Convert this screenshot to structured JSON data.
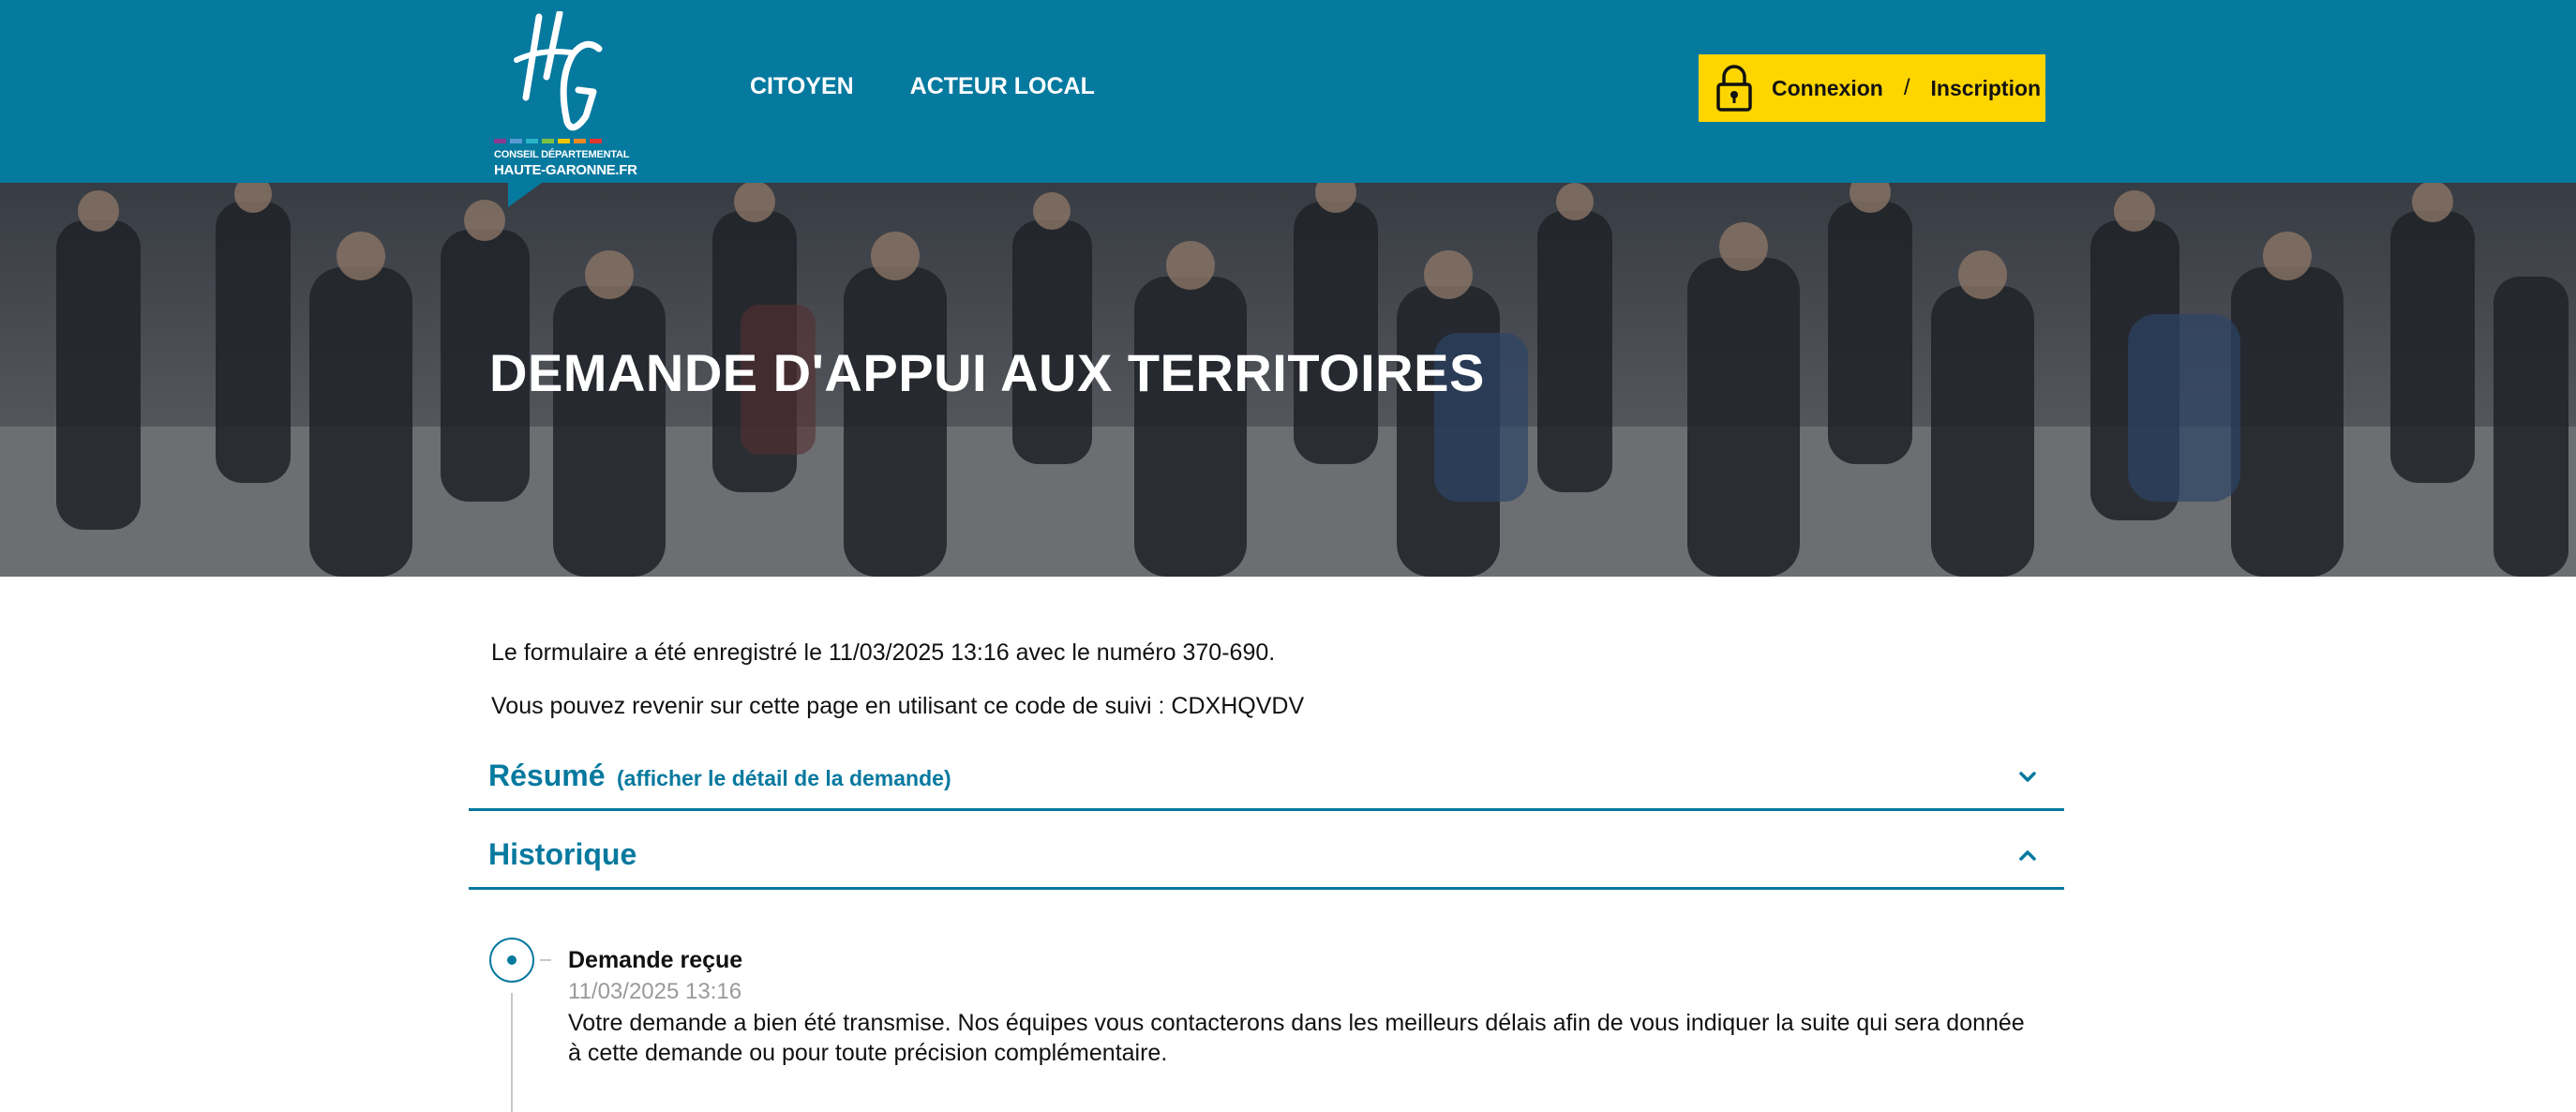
{
  "brand": {
    "logo_letters": "HG",
    "logo_line1": "CONSEIL DÉPARTEMENTAL",
    "logo_line2": "HAUTE-GARONNE.FR",
    "primary_color": "#06799f",
    "accent_color": "#ffd500"
  },
  "nav": {
    "items": [
      {
        "label": "CITOYEN"
      },
      {
        "label": "ACTEUR LOCAL"
      }
    ]
  },
  "auth": {
    "icon": "lock-icon",
    "login_label": "Connexion",
    "separator": "/",
    "signup_label": "Inscription"
  },
  "hero": {
    "title": "DEMANDE D'APPUI AUX TERRITOIRES"
  },
  "confirmation": {
    "saved_text": "Le formulaire a été enregistré le 11/03/2025 13:16 avec le numéro 370-690.",
    "tracking_text": "Vous pouvez revenir sur cette page en utilisant ce code de suivi : CDXHQVDV"
  },
  "sections": {
    "summary": {
      "title": "Résumé",
      "detail_link": "(afficher le détail de la demande)",
      "expanded": false
    },
    "history": {
      "title": "Historique",
      "expanded": true
    }
  },
  "timeline": {
    "events": [
      {
        "title": "Demande reçue",
        "date": "11/03/2025 13:16",
        "text": "Votre demande a bien été transmise. Nos équipes vous contacterons dans les meilleurs délais afin de vous indiquer la suite qui sera donnée à cette demande ou pour toute précision complémentaire."
      }
    ]
  }
}
